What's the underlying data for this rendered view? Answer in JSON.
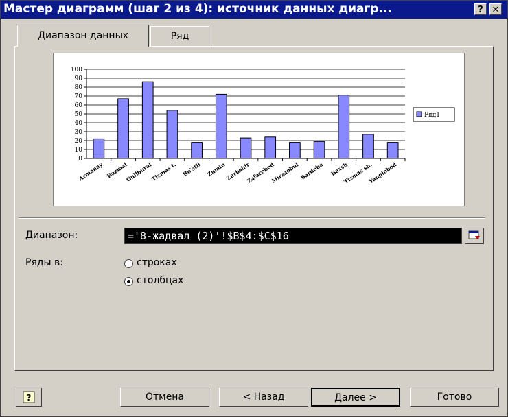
{
  "window": {
    "title": "Мастер диаграмм (шаг 2 из 4): источник данных диагр...",
    "help_btn": "?",
    "close_btn": "✕"
  },
  "tabs": [
    {
      "label": "Диапазон данных",
      "active": true
    },
    {
      "label": "Ряд",
      "active": false
    }
  ],
  "chart_data": {
    "type": "bar",
    "categories": [
      "Armanay",
      "Bazmal",
      "Gullbural",
      "Tizmas t.",
      "Bo'stli",
      "Zumin",
      "Zarbshir",
      "Zafarobod",
      "Mirzaobul",
      "Sardoba",
      "Baxsh",
      "Tizmas sh.",
      "Yangiobod"
    ],
    "series": [
      {
        "name": "Ряд1",
        "values": [
          22,
          67,
          86,
          54,
          18,
          72,
          23,
          24,
          18,
          19,
          71,
          27,
          18
        ],
        "color": "#8888ff"
      }
    ],
    "ylim": [
      0,
      100
    ],
    "yticks": [
      "0",
      "10",
      "20",
      "30",
      "40",
      "50",
      "60",
      "70",
      "80",
      "90",
      "100"
    ],
    "grid": true,
    "legend": "right"
  },
  "source": {
    "range_label": "Диапазон:",
    "range_value": "='8-жадвал (2)'!$B$4:$C$16",
    "series_in_label": "Ряды в:",
    "rows_label": "строках",
    "cols_label": "столбцах",
    "selected": "cols"
  },
  "buttons": {
    "help": "?",
    "cancel": "Отмена",
    "back": "< Назад",
    "next": "Далее >",
    "finish": "Готово"
  }
}
